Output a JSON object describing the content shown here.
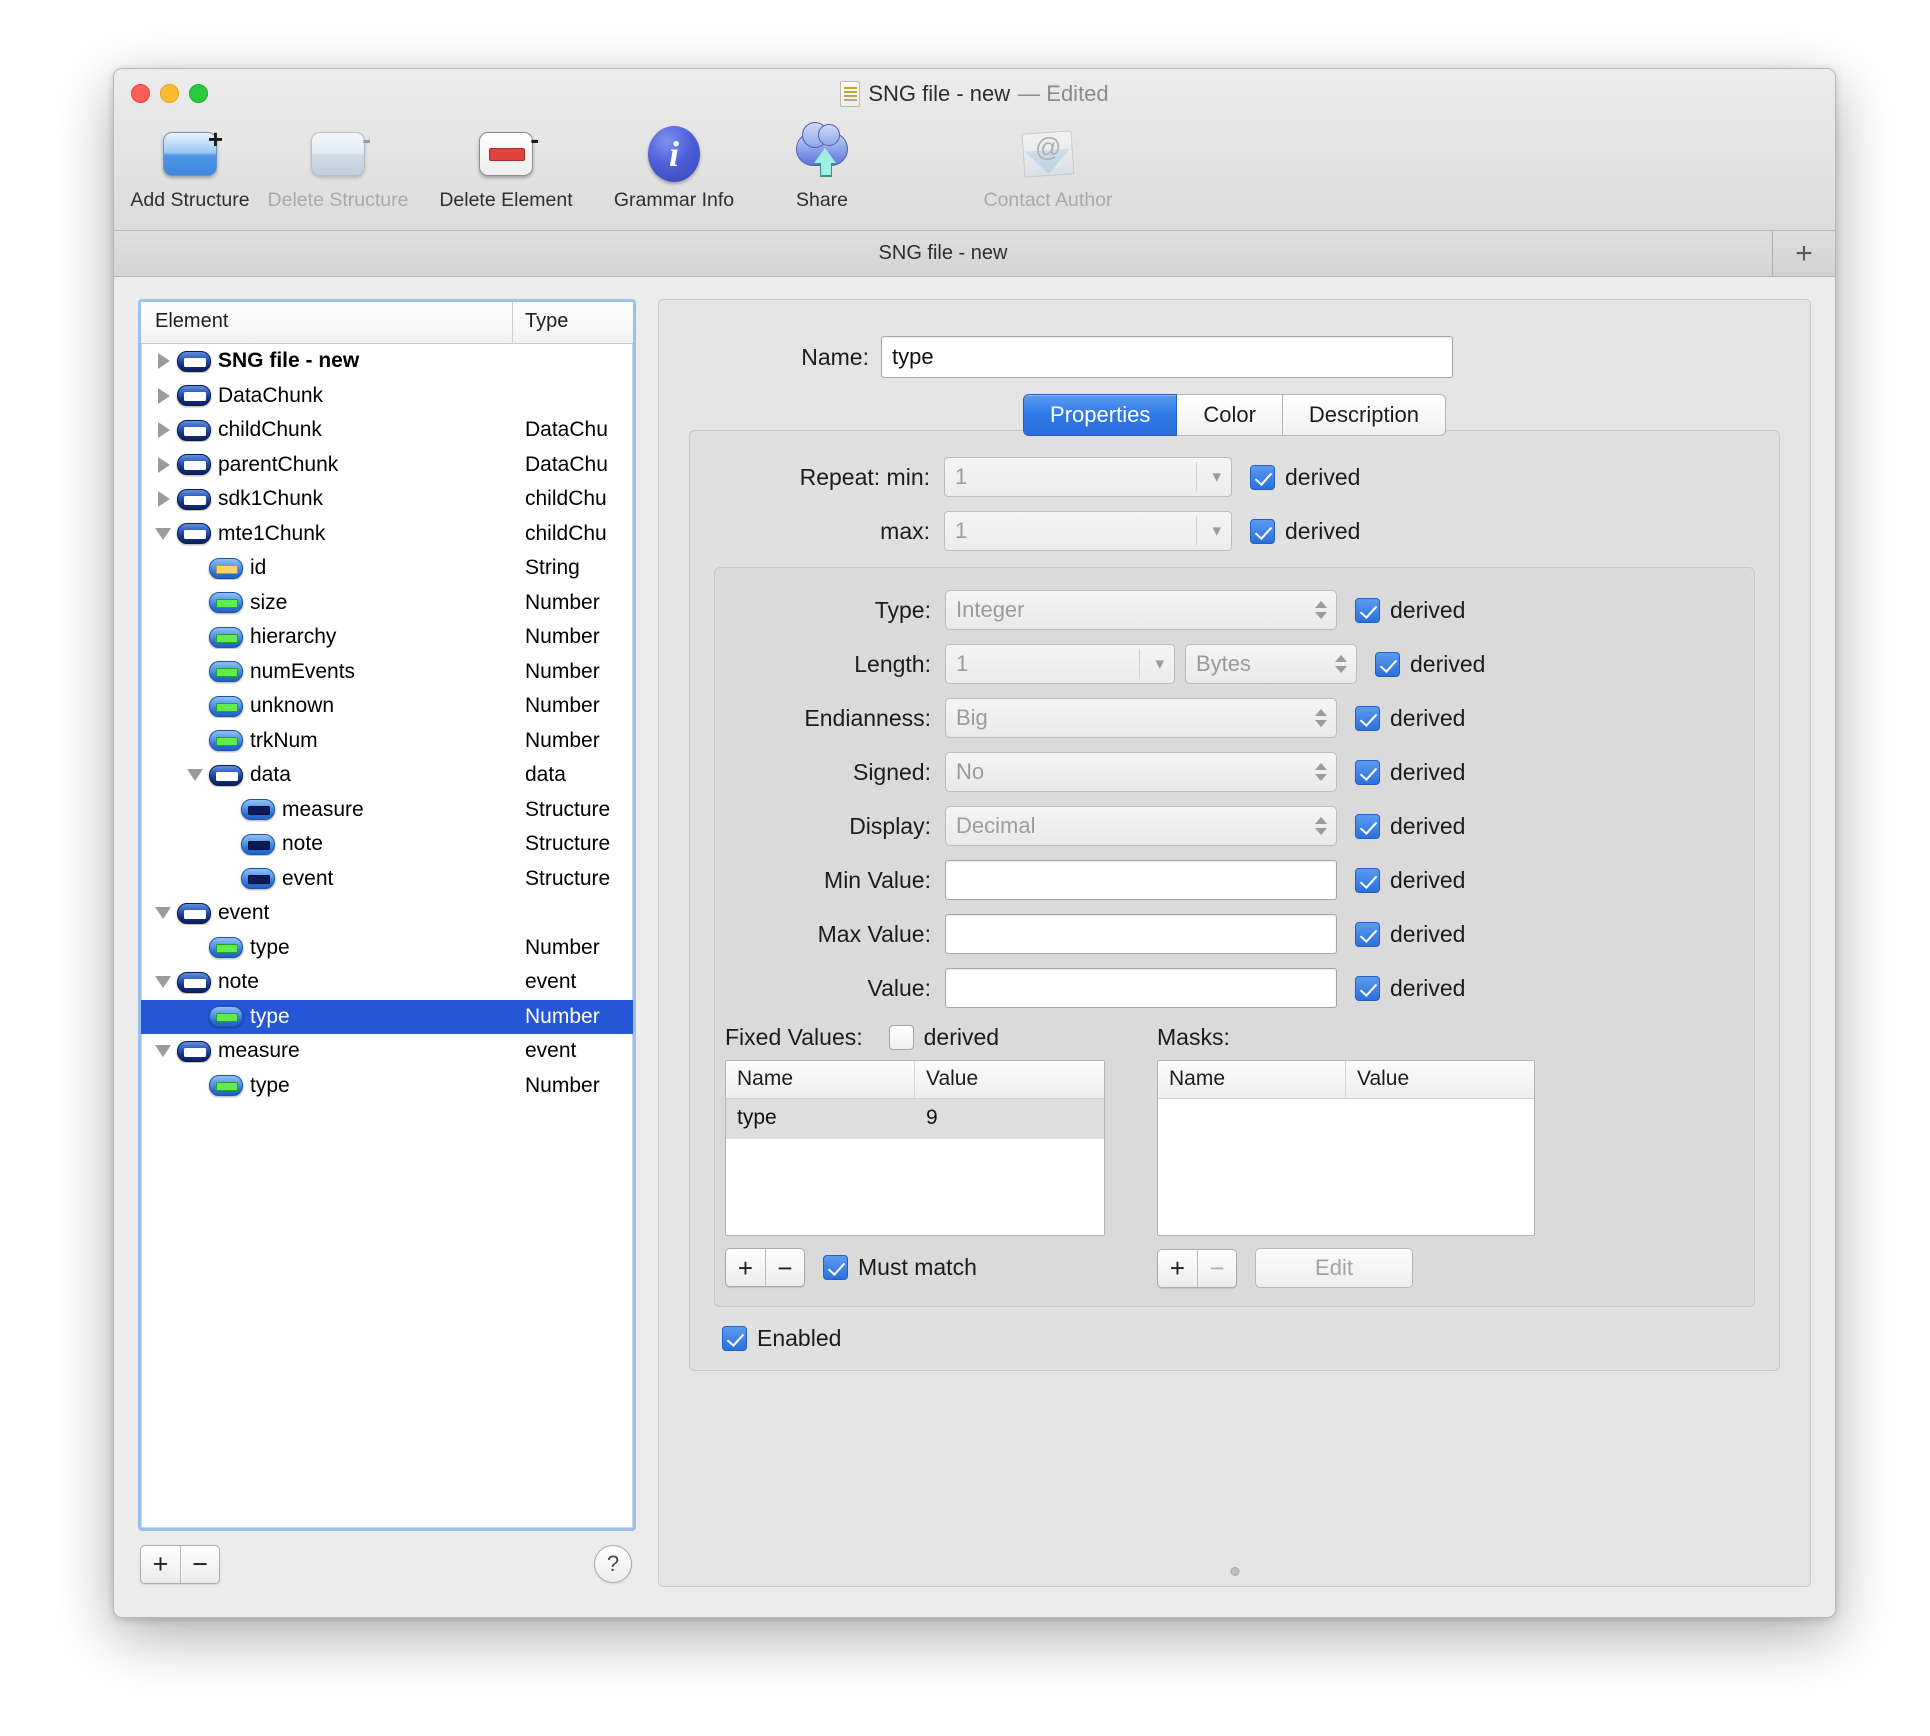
{
  "window": {
    "title": "SNG file - new",
    "title_suffix": "— Edited",
    "doc_icon": "document-icon",
    "traffic": {
      "close": "close-button",
      "minimize": "minimize-button",
      "zoom": "zoom-button"
    }
  },
  "toolbar": {
    "items": [
      {
        "label": "Add Structure",
        "icon": "add-structure-icon",
        "enabled": true,
        "badge": "+"
      },
      {
        "label": "Delete Structure",
        "icon": "delete-structure-icon",
        "enabled": false,
        "badge": "-"
      },
      {
        "label": "Delete Element",
        "icon": "delete-element-icon",
        "enabled": true,
        "badge": "-"
      },
      {
        "label": "Grammar Info",
        "icon": "info-icon",
        "enabled": true,
        "badge": ""
      },
      {
        "label": "Share",
        "icon": "share-icon",
        "enabled": true,
        "badge": ""
      },
      {
        "label": "Contact Author",
        "icon": "mail-icon",
        "enabled": false,
        "badge": ""
      }
    ]
  },
  "tabstrip": {
    "active_tab": "SNG file - new",
    "add_label": "+"
  },
  "outline": {
    "columns": {
      "element": "Element",
      "type": "Type"
    },
    "rows": [
      {
        "name": "SNG file - new",
        "type": "",
        "depth": 0,
        "disclosure": "right",
        "icon": "structure-icon",
        "bar": "white",
        "bold": true,
        "selected": false
      },
      {
        "name": "DataChunk",
        "type": "",
        "depth": 0,
        "disclosure": "right",
        "icon": "structure-icon",
        "bar": "white",
        "bold": false,
        "selected": false
      },
      {
        "name": "childChunk",
        "type": "DataChu",
        "depth": 0,
        "disclosure": "right",
        "icon": "structure-icon",
        "bar": "white",
        "bold": false,
        "selected": false
      },
      {
        "name": "parentChunk",
        "type": "DataChu",
        "depth": 0,
        "disclosure": "right",
        "icon": "structure-icon",
        "bar": "white",
        "bold": false,
        "selected": false
      },
      {
        "name": "sdk1Chunk",
        "type": "childChu",
        "depth": 0,
        "disclosure": "right",
        "icon": "structure-icon",
        "bar": "white",
        "bold": false,
        "selected": false
      },
      {
        "name": "mte1Chunk",
        "type": "childChu",
        "depth": 0,
        "disclosure": "down",
        "icon": "structure-icon",
        "bar": "white",
        "bold": false,
        "selected": false
      },
      {
        "name": "id",
        "type": "String",
        "depth": 1,
        "disclosure": "none",
        "icon": "string-icon",
        "bar": "yellow",
        "bold": false,
        "selected": false
      },
      {
        "name": "size",
        "type": "Number",
        "depth": 1,
        "disclosure": "none",
        "icon": "number-icon",
        "bar": "green",
        "bold": false,
        "selected": false
      },
      {
        "name": "hierarchy",
        "type": "Number",
        "depth": 1,
        "disclosure": "none",
        "icon": "number-icon",
        "bar": "green",
        "bold": false,
        "selected": false
      },
      {
        "name": "numEvents",
        "type": "Number",
        "depth": 1,
        "disclosure": "none",
        "icon": "number-icon",
        "bar": "green",
        "bold": false,
        "selected": false
      },
      {
        "name": "unknown",
        "type": "Number",
        "depth": 1,
        "disclosure": "none",
        "icon": "number-icon",
        "bar": "green",
        "bold": false,
        "selected": false
      },
      {
        "name": "trkNum",
        "type": "Number",
        "depth": 1,
        "disclosure": "none",
        "icon": "number-icon",
        "bar": "green",
        "bold": false,
        "selected": false
      },
      {
        "name": "data",
        "type": "data",
        "depth": 1,
        "disclosure": "down",
        "icon": "structure-icon",
        "bar": "white",
        "bold": false,
        "selected": false
      },
      {
        "name": "measure",
        "type": "Structure",
        "depth": 2,
        "disclosure": "none",
        "icon": "reference-icon",
        "bar": "navy",
        "bold": false,
        "selected": false
      },
      {
        "name": "note",
        "type": "Structure",
        "depth": 2,
        "disclosure": "none",
        "icon": "reference-icon",
        "bar": "navy",
        "bold": false,
        "selected": false
      },
      {
        "name": "event",
        "type": "Structure",
        "depth": 2,
        "disclosure": "none",
        "icon": "reference-icon",
        "bar": "navy",
        "bold": false,
        "selected": false
      },
      {
        "name": "event",
        "type": "",
        "depth": 0,
        "disclosure": "down",
        "icon": "structure-icon",
        "bar": "white",
        "bold": false,
        "selected": false
      },
      {
        "name": "type",
        "type": "Number",
        "depth": 1,
        "disclosure": "none",
        "icon": "number-icon",
        "bar": "green",
        "bold": false,
        "selected": false
      },
      {
        "name": "note",
        "type": "event",
        "depth": 0,
        "disclosure": "down",
        "icon": "structure-icon",
        "bar": "white",
        "bold": false,
        "selected": false
      },
      {
        "name": "type",
        "type": "Number",
        "depth": 1,
        "disclosure": "none",
        "icon": "number-icon",
        "bar": "green",
        "bold": false,
        "selected": true
      },
      {
        "name": "measure",
        "type": "event",
        "depth": 0,
        "disclosure": "down",
        "icon": "structure-icon",
        "bar": "white",
        "bold": false,
        "selected": false
      },
      {
        "name": "type",
        "type": "Number",
        "depth": 1,
        "disclosure": "none",
        "icon": "number-icon",
        "bar": "green",
        "bold": false,
        "selected": false
      }
    ],
    "footer": {
      "add": "+",
      "remove": "−",
      "help": "?"
    }
  },
  "inspector": {
    "name_label": "Name:",
    "name_value": "type",
    "tabs": [
      {
        "label": "Properties",
        "active": true
      },
      {
        "label": "Color",
        "active": false
      },
      {
        "label": "Description",
        "active": false
      }
    ],
    "repeat": {
      "label": "Repeat:",
      "min_label": "min:",
      "min_value": "1",
      "min_derived": {
        "label": "derived",
        "checked": true
      },
      "max_label": "max:",
      "max_value": "1",
      "max_derived": {
        "label": "derived",
        "checked": true
      }
    },
    "fields": [
      {
        "label": "Type:",
        "value": "Integer",
        "control": "popup",
        "derived": {
          "label": "derived",
          "checked": true
        }
      },
      {
        "label": "Length:",
        "value": "1",
        "control": "combo",
        "unit": "Bytes",
        "derived": {
          "label": "derived",
          "checked": true
        }
      },
      {
        "label": "Endianness:",
        "value": "Big",
        "control": "popup",
        "derived": {
          "label": "derived",
          "checked": true
        }
      },
      {
        "label": "Signed:",
        "value": "No",
        "control": "popup",
        "derived": {
          "label": "derived",
          "checked": true
        }
      },
      {
        "label": "Display:",
        "value": "Decimal",
        "control": "popup",
        "derived": {
          "label": "derived",
          "checked": true
        }
      },
      {
        "label": "Min Value:",
        "value": "",
        "control": "text",
        "derived": {
          "label": "derived",
          "checked": true
        }
      },
      {
        "label": "Max Value:",
        "value": "",
        "control": "text",
        "derived": {
          "label": "derived",
          "checked": true
        }
      },
      {
        "label": "Value:",
        "value": "",
        "control": "text",
        "derived": {
          "label": "derived",
          "checked": true
        }
      }
    ],
    "fixed_values": {
      "caption": "Fixed Values:",
      "derived": {
        "label": "derived",
        "checked": false
      },
      "columns": [
        "Name",
        "Value"
      ],
      "rows": [
        {
          "name": "type",
          "value": "9"
        }
      ],
      "add": "+",
      "remove": "−",
      "must_match": {
        "label": "Must match",
        "checked": true
      }
    },
    "masks": {
      "caption": "Masks:",
      "columns": [
        "Name",
        "Value"
      ],
      "rows": [],
      "add": "+",
      "remove": "−",
      "edit_label": "Edit"
    },
    "enabled": {
      "label": "Enabled",
      "checked": true
    }
  },
  "colors": {
    "accent": "#2a6fdd",
    "selection": "#2456d6",
    "window_bg": "#ececec",
    "panel_bg": "#e0e0e0",
    "outline_focus_ring": "#9cc0ea"
  }
}
